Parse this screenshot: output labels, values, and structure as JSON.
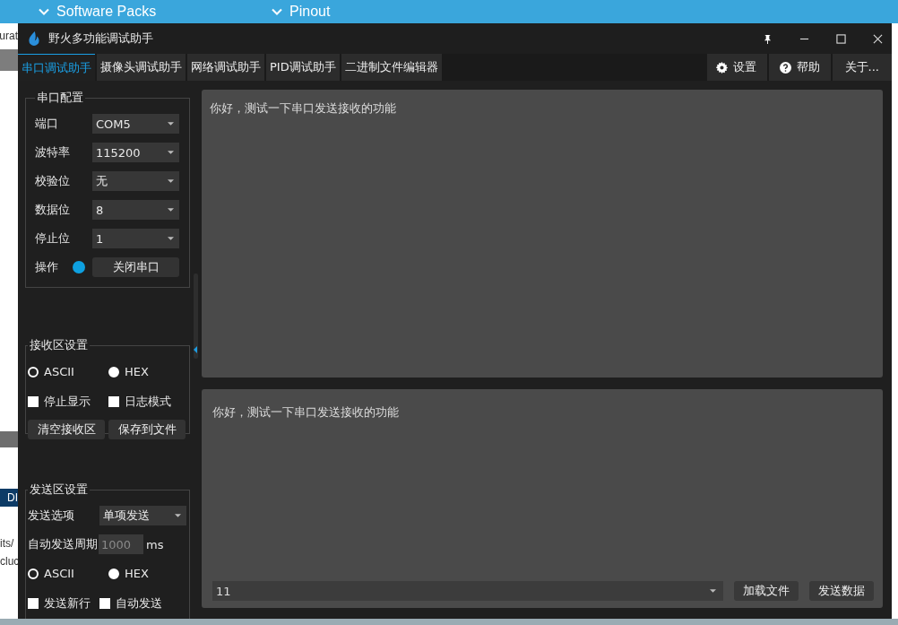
{
  "background_app": {
    "header_items": [
      "Software Packs",
      "Pinout"
    ],
    "fragments": [
      "urat",
      "DI",
      "its/",
      "cluc"
    ]
  },
  "window": {
    "title": "野火多功能调试助手"
  },
  "tabs": [
    {
      "label": "串口调试助手",
      "selected": true
    },
    {
      "label": "摄像头调试助手",
      "selected": false
    },
    {
      "label": "网络调试助手",
      "selected": false
    },
    {
      "label": "PID调试助手",
      "selected": false
    },
    {
      "label": "二进制文件编辑器",
      "selected": false
    }
  ],
  "toolbar_buttons": [
    {
      "kind": "settings",
      "label": "设置"
    },
    {
      "kind": "help",
      "label": "帮助"
    },
    {
      "kind": "plain",
      "label": "关于..."
    }
  ],
  "serial_config": {
    "title": "串口配置",
    "fields": [
      {
        "label": "端口",
        "value": "COM5"
      },
      {
        "label": "波特率",
        "value": "115200"
      },
      {
        "label": "校验位",
        "value": "无"
      },
      {
        "label": "数据位",
        "value": "8"
      },
      {
        "label": "停止位",
        "value": "1"
      }
    ],
    "operation": {
      "label": "操作",
      "connected": true,
      "button": "关闭串口"
    }
  },
  "receive_settings": {
    "title": "接收区设置",
    "modes": [
      {
        "label": "ASCII",
        "selected": true
      },
      {
        "label": "HEX",
        "selected": false
      }
    ],
    "options": [
      {
        "label": "停止显示",
        "checked": false
      },
      {
        "label": "日志模式",
        "checked": false
      }
    ],
    "buttons": [
      "清空接收区",
      "保存到文件"
    ]
  },
  "send_settings": {
    "title": "发送区设置",
    "send_option": {
      "label": "发送选项",
      "value": "单项发送"
    },
    "auto_period": {
      "label": "自动发送周期",
      "placeholder": "1000",
      "unit": "ms"
    },
    "modes": [
      {
        "label": "ASCII",
        "selected": true
      },
      {
        "label": "HEX",
        "selected": false
      }
    ],
    "options": [
      {
        "label": "发送新行",
        "checked": false
      },
      {
        "label": "自动发送",
        "checked": false
      }
    ]
  },
  "receive_area": {
    "text": "你好，测试一下串口发送接收的功能"
  },
  "send_area": {
    "text": "你好，测试一下串口发送接收的功能",
    "history_value": "11",
    "buttons": [
      "加载文件",
      "发送数据"
    ]
  }
}
